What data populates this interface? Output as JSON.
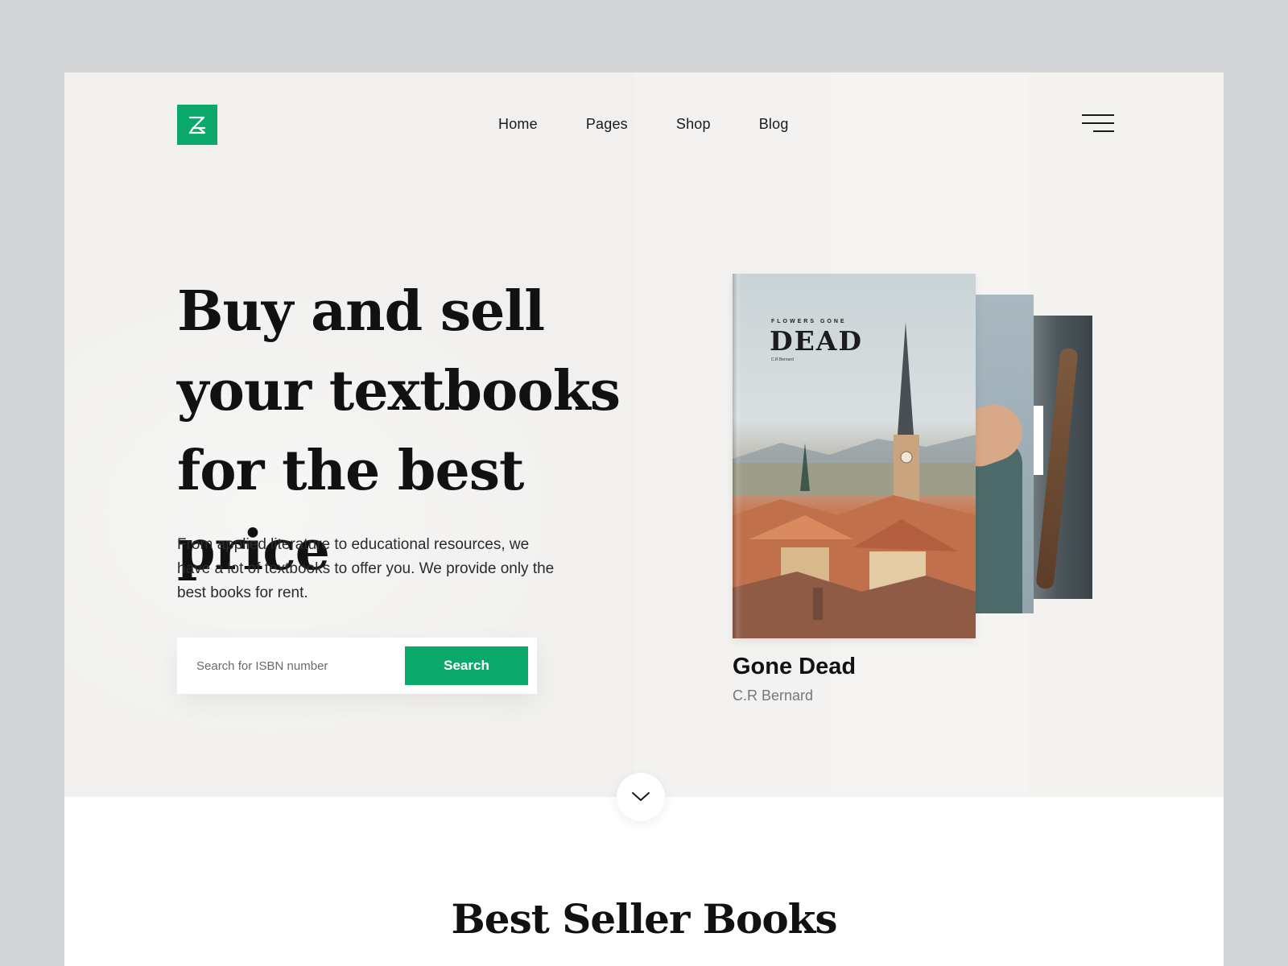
{
  "brand": {
    "logo_icon": "z-monogram-icon",
    "accent": "#0aa86a"
  },
  "nav": {
    "items": [
      {
        "label": "Home"
      },
      {
        "label": "Pages"
      },
      {
        "label": "Shop"
      },
      {
        "label": "Blog"
      }
    ],
    "menu_icon": "hamburger-menu-icon"
  },
  "hero": {
    "headline": "Buy and sell your textbooks for the best price",
    "description": "From applied literature to educational resources, we have a lot of textbooks to offer you. We provide only the best books for rent.",
    "search": {
      "placeholder": "Search for ISBN number",
      "button_label": "Search"
    }
  },
  "featured_book": {
    "cover_kicker": "FLOWERS GONE",
    "cover_title": "DEAD",
    "title": "Gone Dead",
    "author": "C.R Bernard"
  },
  "scroll_icon": "chevron-down-icon",
  "best_sellers": {
    "title": "Best Seller Books"
  }
}
